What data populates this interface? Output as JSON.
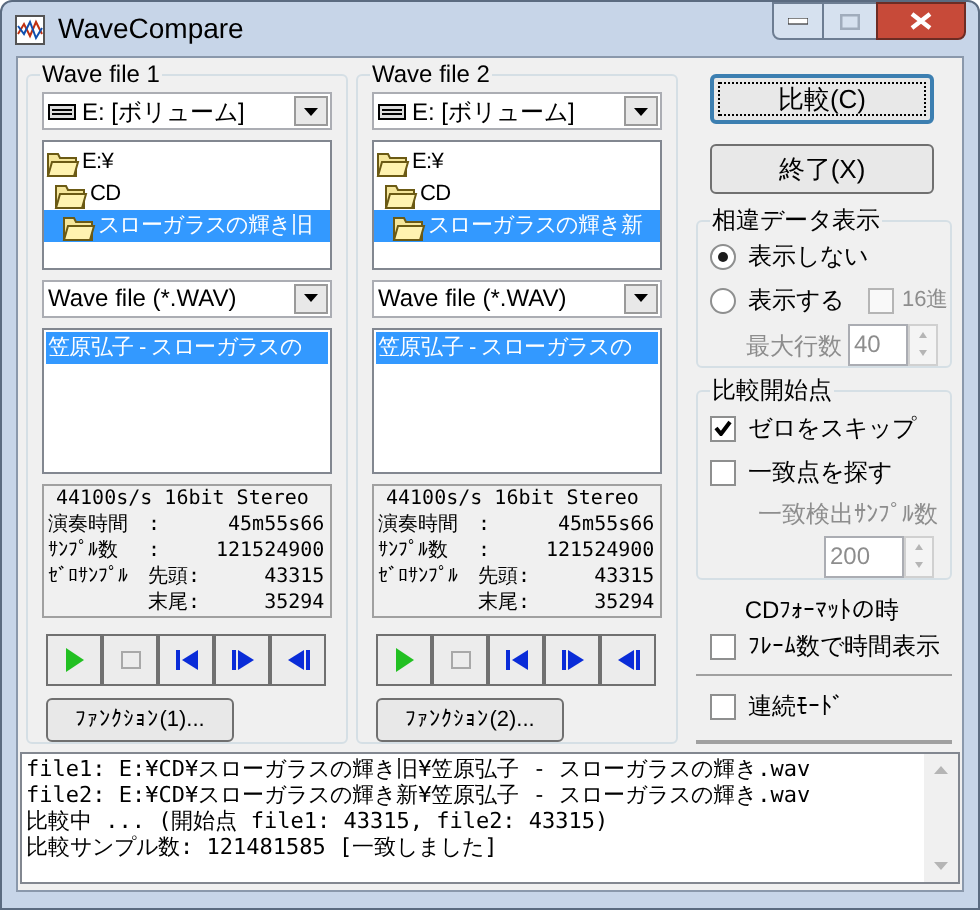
{
  "window": {
    "title": "WaveCompare"
  },
  "file_panels": [
    {
      "title": "Wave file 1",
      "drive": "E: [ボリューム]",
      "folders": [
        {
          "name": "E:¥",
          "selected": false,
          "children": [
            {
              "name": "CD",
              "selected": false,
              "children": [
                {
                  "name": "スローガラスの輝き旧",
                  "selected": true
                }
              ]
            }
          ]
        }
      ],
      "filter": "Wave file (*.WAV)",
      "files": [
        {
          "name": "笠原弘子 - スローガラスの",
          "selected": true
        }
      ],
      "info": {
        "format": "44100s/s 16bit Stereo",
        "rows": [
          {
            "label": "演奏時間",
            "mid": ":",
            "value": "45m55s66"
          },
          {
            "label": "ｻﾝﾌﾟﾙ数",
            "mid": ":",
            "value": "121524900"
          },
          {
            "label": "ｾﾞﾛｻﾝﾌﾟﾙ",
            "mid": "先頭:",
            "value": "43315"
          },
          {
            "mid": "末尾:",
            "value": "35294"
          }
        ]
      },
      "function_button": "ﾌｧﾝｸｼｮﾝ(1)..."
    },
    {
      "title": "Wave file 2",
      "drive": "E: [ボリューム]",
      "folders": [
        {
          "name": "E:¥",
          "selected": false,
          "children": [
            {
              "name": "CD",
              "selected": false,
              "children": [
                {
                  "name": "スローガラスの輝き新",
                  "selected": true
                }
              ]
            }
          ]
        }
      ],
      "filter": "Wave file (*.WAV)",
      "files": [
        {
          "name": "笠原弘子 - スローガラスの",
          "selected": true
        }
      ],
      "info": {
        "format": "44100s/s 16bit Stereo",
        "rows": [
          {
            "label": "演奏時間",
            "mid": ":",
            "value": "45m55s66"
          },
          {
            "label": "ｻﾝﾌﾟﾙ数",
            "mid": ":",
            "value": "121524900"
          },
          {
            "label": "ｾﾞﾛｻﾝﾌﾟﾙ",
            "mid": "先頭:",
            "value": "43315"
          },
          {
            "mid": "末尾:",
            "value": "35294"
          }
        ]
      },
      "function_button": "ﾌｧﾝｸｼｮﾝ(2)..."
    }
  ],
  "actions": [
    {
      "label": "比較(C)",
      "focused": true
    },
    {
      "label": "終了(X)",
      "focused": false
    }
  ],
  "diff_display": {
    "title": "相違データ表示",
    "options": [
      {
        "label": "表示しない",
        "selected": true
      },
      {
        "label": "表示する",
        "selected": false
      }
    ],
    "hex": {
      "label": "16進",
      "checked": false,
      "disabled": true
    },
    "max_rows": {
      "label": "最大行数",
      "value": "40",
      "disabled": true
    }
  },
  "start_point": {
    "title": "比較開始点",
    "options": [
      {
        "label": "ゼロをスキップ",
        "checked": true
      },
      {
        "label": "一致点を探す",
        "checked": false
      }
    ],
    "match_samples": {
      "label": "一致検出ｻﾝﾌﾟﾙ数",
      "value": "200",
      "disabled": true
    }
  },
  "cd_format": {
    "caption": "CDﾌｫｰﾏｯﾄの時",
    "label": "ﾌﾚｰﾑ数で時間表示",
    "checked": false
  },
  "continuous": {
    "label": "連続ﾓｰﾄﾞ",
    "checked": false
  },
  "log": [
    "file1: E:¥CD¥スローガラスの輝き旧¥笠原弘子 - スローガラスの輝き.wav",
    "file2: E:¥CD¥スローガラスの輝き新¥笠原弘子 - スローガラスの輝き.wav",
    "比較中 ... (開始点 file1: 43315, file2: 43315)",
    "比較サンプル数: 121481585 [一致しました]"
  ]
}
